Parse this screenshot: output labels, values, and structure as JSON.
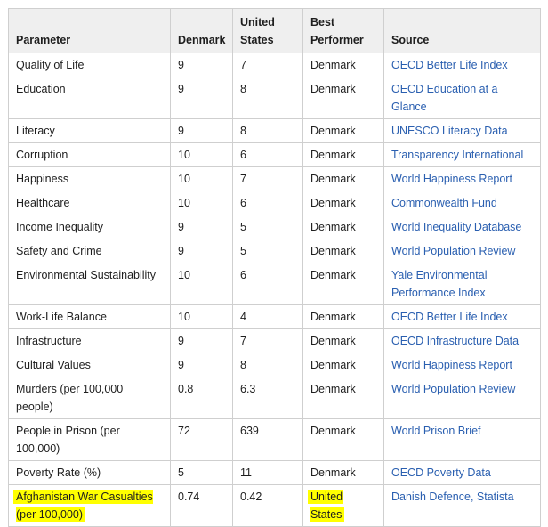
{
  "table": {
    "headers": [
      "Parameter",
      "Denmark",
      "United States",
      "Best Performer",
      "Source"
    ],
    "rows": [
      {
        "parameter": "Quality of Life",
        "denmark": "9",
        "us": "7",
        "best": "Denmark",
        "source": "OECD Better Life Index"
      },
      {
        "parameter": "Education",
        "denmark": "9",
        "us": "8",
        "best": "Denmark",
        "source": "OECD Education at a Glance"
      },
      {
        "parameter": "Literacy",
        "denmark": "9",
        "us": "8",
        "best": "Denmark",
        "source": "UNESCO Literacy Data"
      },
      {
        "parameter": "Corruption",
        "denmark": "10",
        "us": "6",
        "best": "Denmark",
        "source": "Transparency International"
      },
      {
        "parameter": "Happiness",
        "denmark": "10",
        "us": "7",
        "best": "Denmark",
        "source": "World Happiness Report"
      },
      {
        "parameter": "Healthcare",
        "denmark": "10",
        "us": "6",
        "best": "Denmark",
        "source": "Commonwealth Fund"
      },
      {
        "parameter": "Income Inequality",
        "denmark": "9",
        "us": "5",
        "best": "Denmark",
        "source": "World Inequality Database"
      },
      {
        "parameter": "Safety and Crime",
        "denmark": "9",
        "us": "5",
        "best": "Denmark",
        "source": "World Population Review"
      },
      {
        "parameter": "Environmental Sustainability",
        "denmark": "10",
        "us": "6",
        "best": "Denmark",
        "source": "Yale Environmental Performance Index"
      },
      {
        "parameter": "Work-Life Balance",
        "denmark": "10",
        "us": "4",
        "best": "Denmark",
        "source": "OECD Better Life Index"
      },
      {
        "parameter": "Infrastructure",
        "denmark": "9",
        "us": "7",
        "best": "Denmark",
        "source": "OECD Infrastructure Data"
      },
      {
        "parameter": "Cultural Values",
        "denmark": "9",
        "us": "8",
        "best": "Denmark",
        "source": "World Happiness Report"
      },
      {
        "parameter": "Murders (per 100,000 people)",
        "denmark": "0.8",
        "us": "6.3",
        "best": "Denmark",
        "source": "World Population Review"
      },
      {
        "parameter": "People in Prison (per 100,000)",
        "denmark": "72",
        "us": "639",
        "best": "Denmark",
        "source": "World Prison Brief"
      },
      {
        "parameter": "Poverty Rate (%)",
        "denmark": "5",
        "us": "11",
        "best": "Denmark",
        "source": "OECD Poverty Data"
      },
      {
        "parameter": "Afghanistan War Casualties (per 100,000)",
        "denmark": "0.74",
        "us": "0.42",
        "best": "United States",
        "source": "Danish Defence, Statista"
      }
    ]
  },
  "highlight_color": "#ffff00",
  "link_color": "#2a5fb0"
}
